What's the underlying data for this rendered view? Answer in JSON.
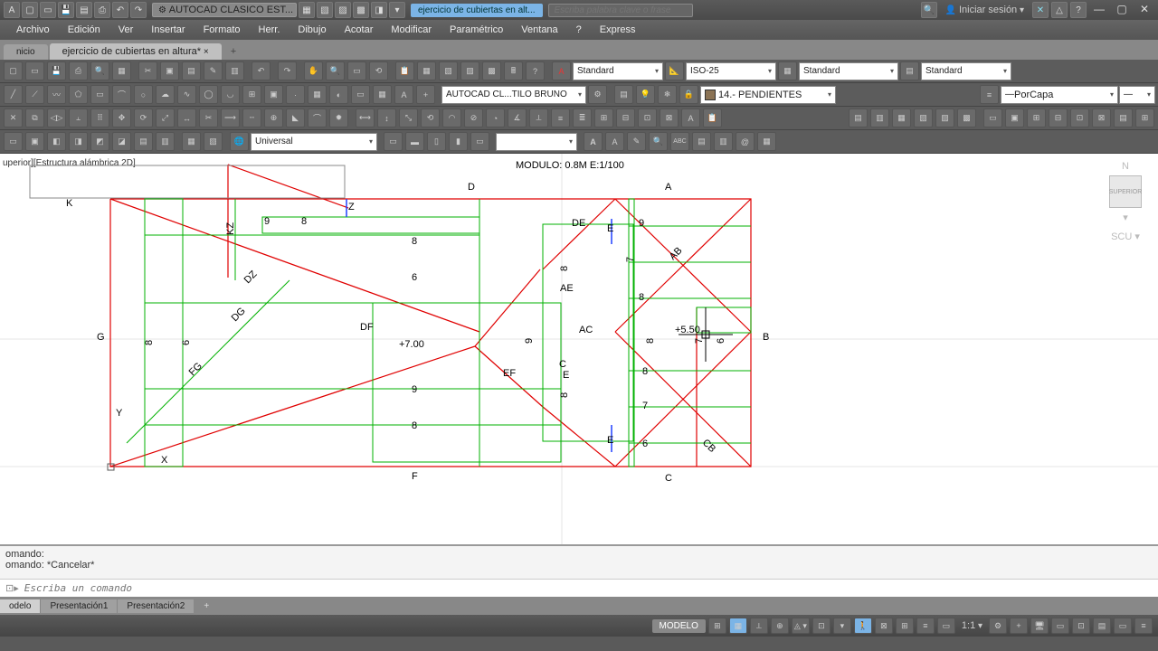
{
  "title": {
    "workspace": "AUTOCAD CLASICO EST...",
    "file_tab": "ejercicio de cubiertas en alt...",
    "search_placeholder": "Escriba palabra clave o frase",
    "login": "Iniciar sesión"
  },
  "menu": [
    "Archivo",
    "Edición",
    "Ver",
    "Insertar",
    "Formato",
    "Herr.",
    "Dibujo",
    "Acotar",
    "Modificar",
    "Paramétrico",
    "Ventana",
    "?",
    "Express"
  ],
  "doc_tabs": {
    "inactive": "nicio",
    "active": "ejercicio de cubiertas en altura*"
  },
  "tool_dropdowns": {
    "textstyle": "Standard",
    "dimstyle": "ISO-25",
    "tablestyle": "Standard",
    "mleader": "Standard",
    "wspace_drop": "AUTOCAD CL...TILO BRUNO",
    "layer": "14.- PENDIENTES",
    "linetype": "PorCapa",
    "block_filter": "Universal"
  },
  "viewport_label": "uperior][Estructura alámbrica 2D]",
  "drawing_title": "MODULO: 0.8M E:1/100",
  "labels": {
    "A": "A",
    "B": "B",
    "C": "C",
    "D": "D",
    "E": "E",
    "F": "F",
    "G": "G",
    "K": "K",
    "X": "X",
    "Y": "Y",
    "Z": "Z",
    "DF": "DF",
    "AC": "AC",
    "EF": "EF",
    "DZ": "DZ",
    "FG": "FG",
    "DG": "DG",
    "KZ": "KZ",
    "AB": "AB",
    "CB": "CB",
    "AE": "AE",
    "DE": "DE",
    "p7": "+7.00",
    "p55": "+5.50",
    "n6": "6",
    "n7": "7",
    "n8": "8",
    "n9": "9"
  },
  "viewcube": {
    "n": "N",
    "scu": "SCU",
    "face": "SUPERIOR"
  },
  "command": {
    "hist1": "omando:",
    "hist2": "omando: *Cancelar*",
    "prompt": "Escriba un comando"
  },
  "layout_tabs": [
    "odelo",
    "Presentación1",
    "Presentación2"
  ],
  "status": {
    "modelo": "MODELO",
    "scale": "1:1"
  }
}
